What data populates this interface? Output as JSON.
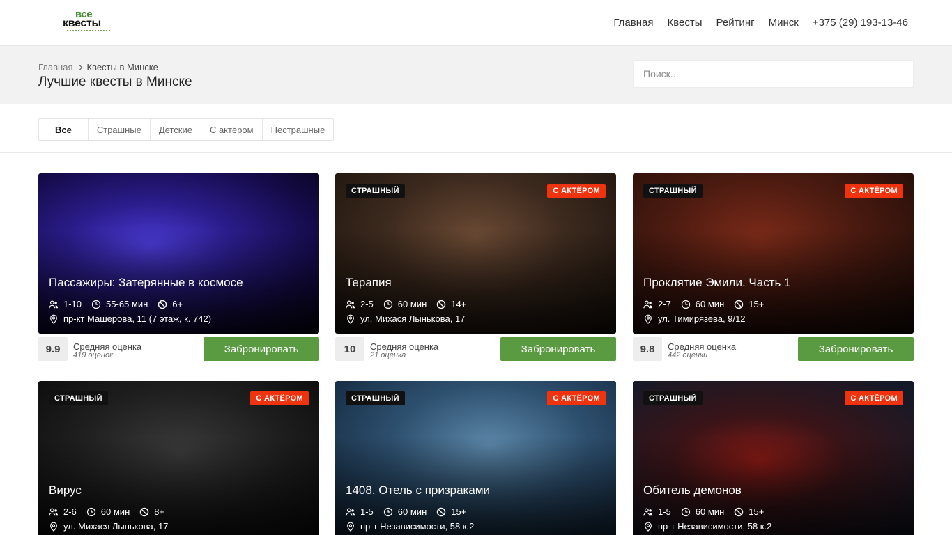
{
  "logo": {
    "top": "все",
    "main": "квесты"
  },
  "nav": [
    "Главная",
    "Квесты",
    "Рейтинг",
    "Минск",
    "+375 (29) 193-13-46"
  ],
  "breadcrumb": {
    "home": "Главная",
    "current": "Квесты в Минске"
  },
  "page_title": "Лучшие квесты в Минске",
  "search": {
    "placeholder": "Поиск..."
  },
  "filters": [
    "Все",
    "Страшные",
    "Детские",
    "С актёром",
    "Нестрашные"
  ],
  "rating_label": "Средняя оценка",
  "book_label": "Забронировать",
  "quests": [
    {
      "title": "Пассажиры: Затерянные в космосе",
      "players": "1-10",
      "duration": "55-65 мин",
      "age": "6+",
      "address": "пр-кт Машерова, 11 (7 этаж, к. 742)",
      "score": "9.9",
      "reviews": "419 оценок",
      "tag_scary": "",
      "tag_actor": ""
    },
    {
      "title": "Терапия",
      "players": "2-5",
      "duration": "60 мин",
      "age": "14+",
      "address": "ул. Михася Лынькова, 17",
      "score": "10",
      "reviews": "21 оценка",
      "tag_scary": "СТРАШНЫЙ",
      "tag_actor": "С АКТЁРОМ"
    },
    {
      "title": "Проклятие Эмили. Часть 1",
      "players": "2-7",
      "duration": "60 мин",
      "age": "15+",
      "address": "ул. Тимирязева, 9/12",
      "score": "9.8",
      "reviews": "442 оценки",
      "tag_scary": "СТРАШНЫЙ",
      "tag_actor": "С АКТЁРОМ"
    },
    {
      "title": "Вирус",
      "players": "2-6",
      "duration": "60 мин",
      "age": "8+",
      "address": "ул. Михася Лынькова, 17",
      "tag_scary": "СТРАШНЫЙ",
      "tag_actor": "С АКТЁРОМ"
    },
    {
      "title": "1408. Отель с призраками",
      "players": "1-5",
      "duration": "60 мин",
      "age": "15+",
      "address": "пр-т Независимости, 58 к.2",
      "tag_scary": "СТРАШНЫЙ",
      "tag_actor": "С АКТЁРОМ"
    },
    {
      "title": "Обитель демонов",
      "players": "1-5",
      "duration": "60 мин",
      "age": "15+",
      "address": "пр-т Независимости, 58 к.2",
      "tag_scary": "СТРАШНЫЙ",
      "tag_actor": "С АКТЁРОМ"
    }
  ]
}
